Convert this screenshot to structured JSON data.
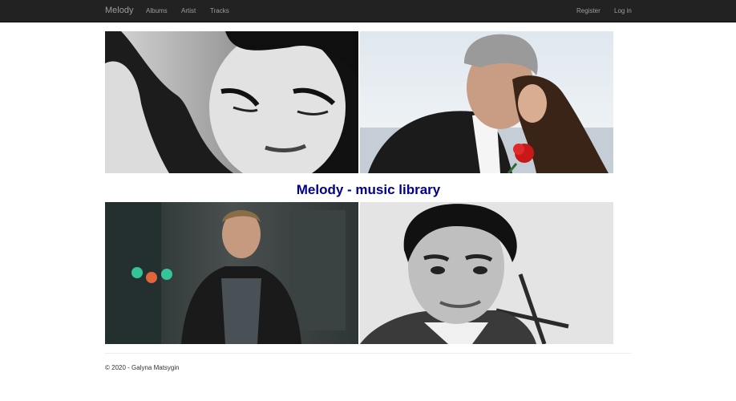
{
  "nav": {
    "brand": "Melody",
    "links": [
      "Albums",
      "Artist",
      "Tracks"
    ],
    "auth": {
      "register": "Register",
      "login": "Log in"
    }
  },
  "main": {
    "heading": "Melody - music library",
    "photos": [
      {
        "icon": "woman-bw-portrait-photo"
      },
      {
        "icon": "couple-with-rose-photo"
      },
      {
        "icon": "man-leather-jacket-photo"
      },
      {
        "icon": "man-bw-portrait-photo"
      }
    ]
  },
  "footer": {
    "text": "© 2020 - Galyna Matsygin"
  },
  "colors": {
    "navbar_bg": "#222222",
    "nav_text": "#9d9d9d",
    "heading": "#00008b"
  }
}
